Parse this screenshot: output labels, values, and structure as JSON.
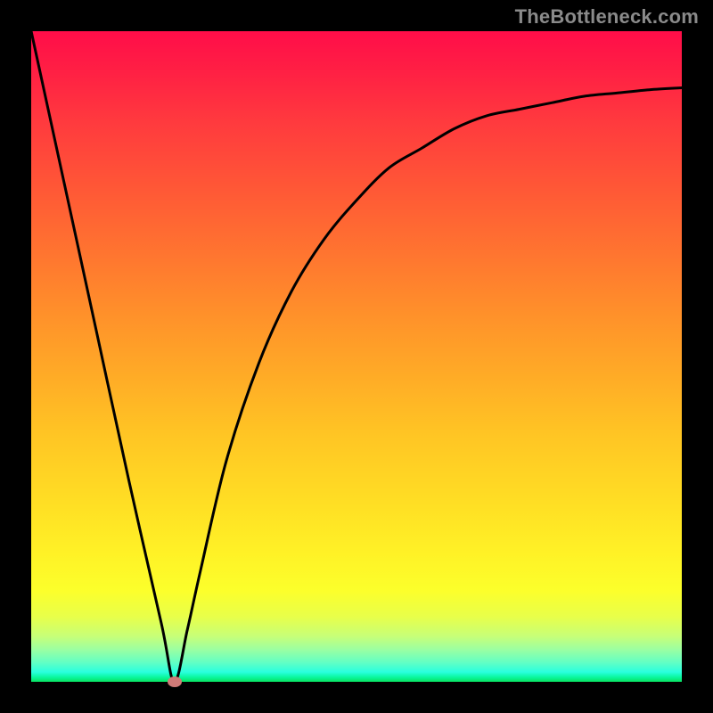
{
  "watermark": "TheBottleneck.com",
  "chart_data": {
    "type": "line",
    "title": "",
    "xlabel": "",
    "ylabel": "",
    "xlim": [
      0,
      100
    ],
    "ylim": [
      0,
      100
    ],
    "grid": false,
    "background": "red-yellow-green-gradient",
    "series": [
      {
        "name": "bottleneck-curve",
        "x": [
          0,
          5,
          10,
          15,
          20,
          22,
          24,
          26,
          30,
          35,
          40,
          45,
          50,
          55,
          60,
          65,
          70,
          75,
          80,
          85,
          90,
          95,
          100
        ],
        "values": [
          100,
          77,
          54,
          31,
          9,
          0,
          8,
          17,
          34,
          49,
          60,
          68,
          74,
          79,
          82,
          85,
          87,
          88,
          89,
          90,
          90.5,
          91,
          91.3
        ]
      }
    ],
    "marker": {
      "x": 22,
      "y": 0,
      "color": "#d07b78"
    }
  }
}
